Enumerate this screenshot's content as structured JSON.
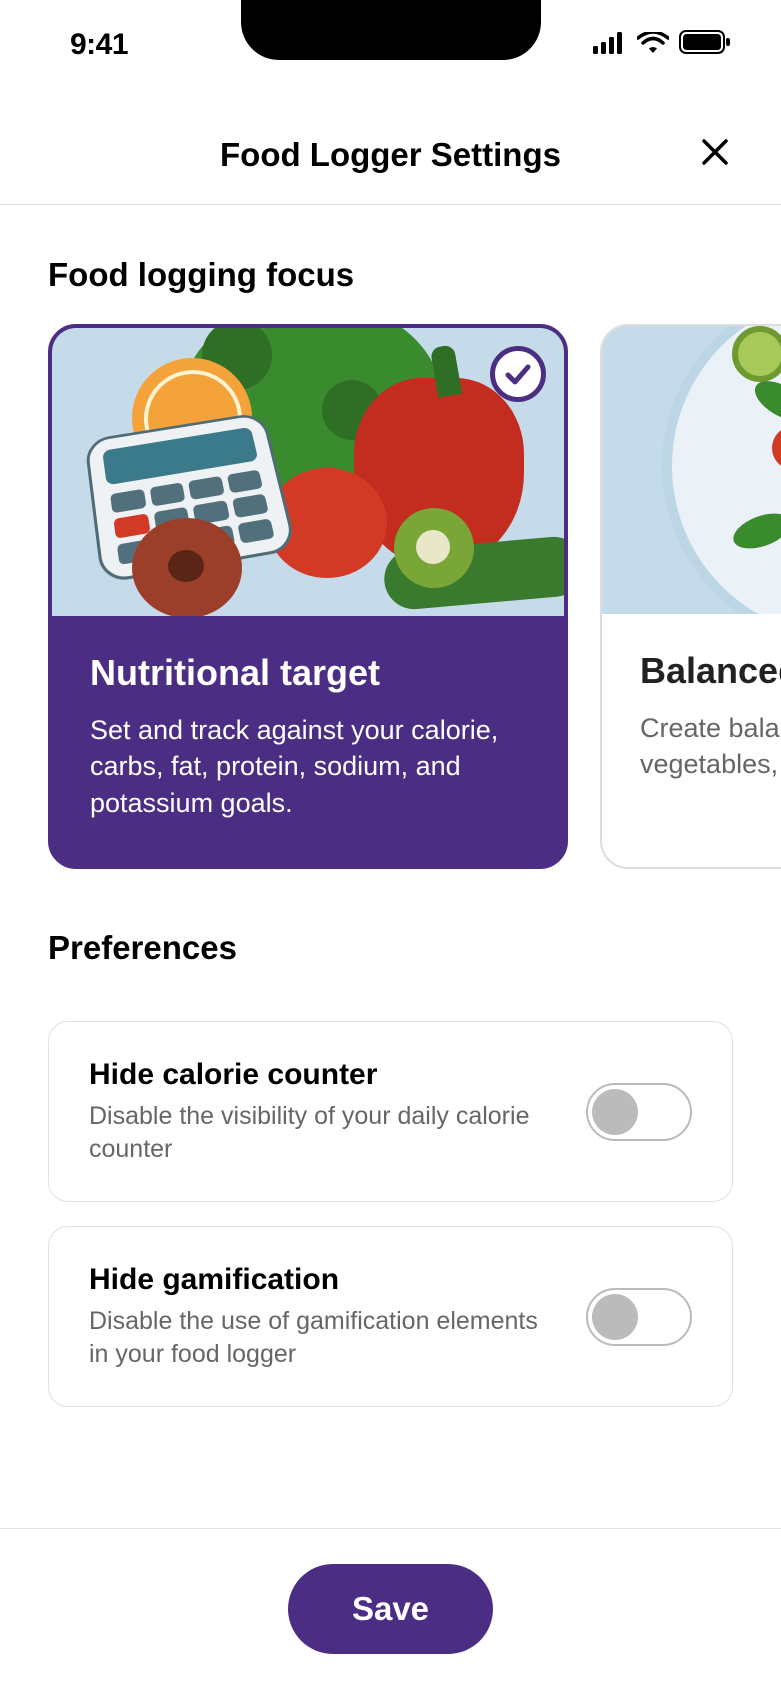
{
  "status": {
    "time": "9:41"
  },
  "header": {
    "title": "Food Logger Settings"
  },
  "sections": {
    "focus": {
      "title": "Food logging focus",
      "cards": [
        {
          "title": "Nutritional target",
          "desc": "Set and track against your calorie, carbs, fat, protein, sodium, and potassium goals.",
          "selected": true
        },
        {
          "title": "Balanced plate",
          "desc": "Create balanced meals with protein, vegetables, grains and more.",
          "selected": false
        }
      ]
    },
    "prefs": {
      "title": "Preferences",
      "items": [
        {
          "title": "Hide calorie counter",
          "desc": "Disable the visibility of your daily calorie counter",
          "on": false
        },
        {
          "title": "Hide gamification",
          "desc": "Disable the use of gamification elements in your food logger",
          "on": false
        }
      ]
    }
  },
  "footer": {
    "save_label": "Save"
  },
  "colors": {
    "accent": "#4b2e83"
  }
}
